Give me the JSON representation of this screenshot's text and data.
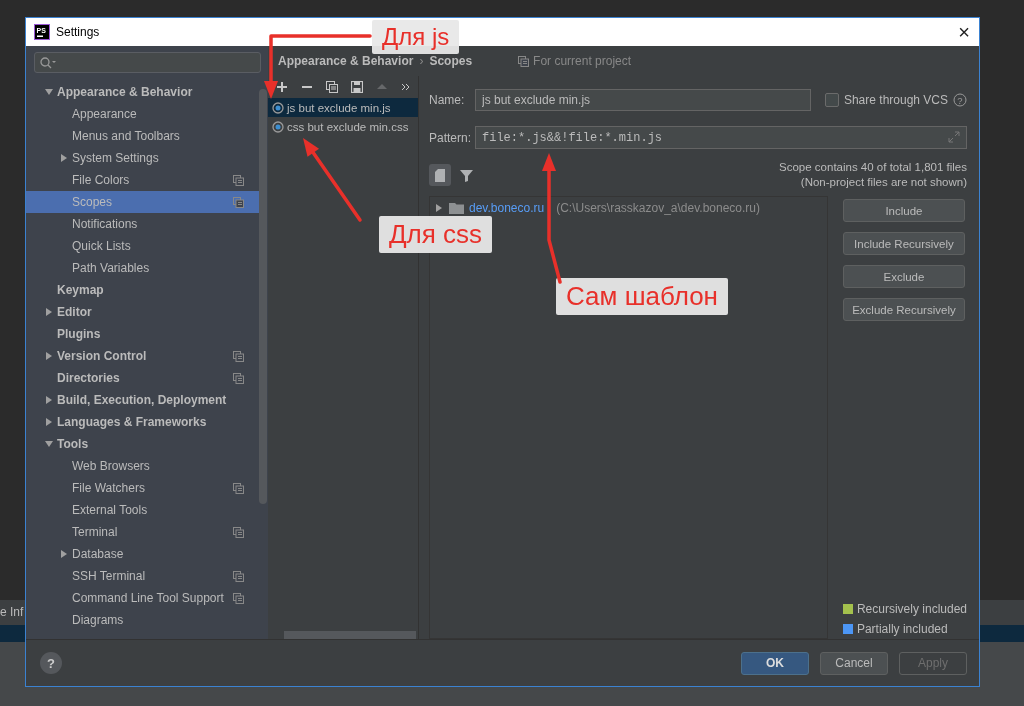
{
  "background": {
    "side_text": "e Inf"
  },
  "window": {
    "logo": "PS",
    "title": "Settings",
    "close": "×"
  },
  "sidebar": {
    "items": [
      {
        "label": "Appearance & Behavior",
        "kind": "branch",
        "expanded": true,
        "selected": false,
        "shared": false,
        "children": [
          {
            "label": "Appearance",
            "kind": "leaf",
            "selected": false,
            "shared": false
          },
          {
            "label": "Menus and Toolbars",
            "kind": "leaf",
            "selected": false,
            "shared": false
          },
          {
            "label": "System Settings",
            "kind": "branch",
            "expanded": false,
            "selected": false,
            "shared": false
          },
          {
            "label": "File Colors",
            "kind": "leaf",
            "selected": false,
            "shared": true
          },
          {
            "label": "Scopes",
            "kind": "leaf",
            "selected": true,
            "shared": true
          },
          {
            "label": "Notifications",
            "kind": "leaf",
            "selected": false,
            "shared": false
          },
          {
            "label": "Quick Lists",
            "kind": "leaf",
            "selected": false,
            "shared": false
          },
          {
            "label": "Path Variables",
            "kind": "leaf",
            "selected": false,
            "shared": false
          }
        ]
      },
      {
        "label": "Keymap",
        "kind": "leaf",
        "selected": false,
        "shared": false
      },
      {
        "label": "Editor",
        "kind": "branch",
        "expanded": false,
        "selected": false,
        "shared": false
      },
      {
        "label": "Plugins",
        "kind": "leaf",
        "selected": false,
        "shared": false
      },
      {
        "label": "Version Control",
        "kind": "branch",
        "expanded": false,
        "selected": false,
        "shared": true
      },
      {
        "label": "Directories",
        "kind": "leaf",
        "selected": false,
        "shared": true
      },
      {
        "label": "Build, Execution, Deployment",
        "kind": "branch",
        "expanded": false,
        "selected": false,
        "shared": false
      },
      {
        "label": "Languages & Frameworks",
        "kind": "branch",
        "expanded": false,
        "selected": false,
        "shared": false
      },
      {
        "label": "Tools",
        "kind": "branch",
        "expanded": true,
        "selected": false,
        "shared": false,
        "children": [
          {
            "label": "Web Browsers",
            "kind": "leaf",
            "selected": false,
            "shared": false
          },
          {
            "label": "File Watchers",
            "kind": "leaf",
            "selected": false,
            "shared": true
          },
          {
            "label": "External Tools",
            "kind": "leaf",
            "selected": false,
            "shared": false
          },
          {
            "label": "Terminal",
            "kind": "leaf",
            "selected": false,
            "shared": true
          },
          {
            "label": "Database",
            "kind": "branch",
            "expanded": false,
            "selected": false,
            "shared": false
          },
          {
            "label": "SSH Terminal",
            "kind": "leaf",
            "selected": false,
            "shared": true
          },
          {
            "label": "Command Line Tool Support",
            "kind": "leaf",
            "selected": false,
            "shared": true
          },
          {
            "label": "Diagrams",
            "kind": "leaf",
            "selected": false,
            "shared": false
          }
        ]
      }
    ]
  },
  "breadcrumb": {
    "items": [
      "Appearance & Behavior",
      "Scopes"
    ],
    "separator": "›",
    "scope_note": "For current project"
  },
  "scopes": {
    "toolbar": [
      {
        "kind": "add",
        "disabled": false
      },
      {
        "kind": "remove",
        "disabled": false
      },
      {
        "kind": "copy",
        "disabled": false
      },
      {
        "kind": "save",
        "disabled": false
      },
      {
        "kind": "up",
        "disabled": true
      },
      {
        "kind": "more",
        "disabled": false
      }
    ],
    "items": [
      {
        "label": "js but exclude min.js",
        "selected": true
      },
      {
        "label": "css but exclude min.css",
        "selected": false
      }
    ]
  },
  "editor": {
    "name_label": "Name:",
    "name": "js but exclude min.js",
    "share_label": "Share through VCS",
    "share_checked": false,
    "share_help": "?",
    "pattern_label": "Pattern:",
    "pattern": "file:*.js&&!file:*.min.js",
    "summary": [
      "Scope contains 40 of total 1,801 files",
      "(Non-project files are not shown)"
    ],
    "tree": [
      {
        "name": "dev.boneco.ru",
        "path": "(C:\\Users\\rasskazov_a\\dev.boneco.ru)",
        "kind": "branch",
        "expanded": false
      }
    ],
    "buttons": [
      "Include",
      "Include Recursively",
      "Exclude",
      "Exclude Recursively"
    ],
    "legend": [
      {
        "label": "Recursively included",
        "color": "#a4c14d"
      },
      {
        "label": "Partially included",
        "color": "#4c96f5"
      }
    ]
  },
  "footer": {
    "help": "?",
    "buttons": [
      {
        "label": "OK",
        "kind": "default",
        "disabled": false
      },
      {
        "label": "Cancel",
        "kind": "normal",
        "disabled": false
      },
      {
        "label": "Apply",
        "kind": "normal",
        "disabled": true
      }
    ]
  },
  "annotations": [
    {
      "text": "Для js"
    },
    {
      "text": "Для css"
    },
    {
      "text": "Сам шаблон"
    }
  ]
}
